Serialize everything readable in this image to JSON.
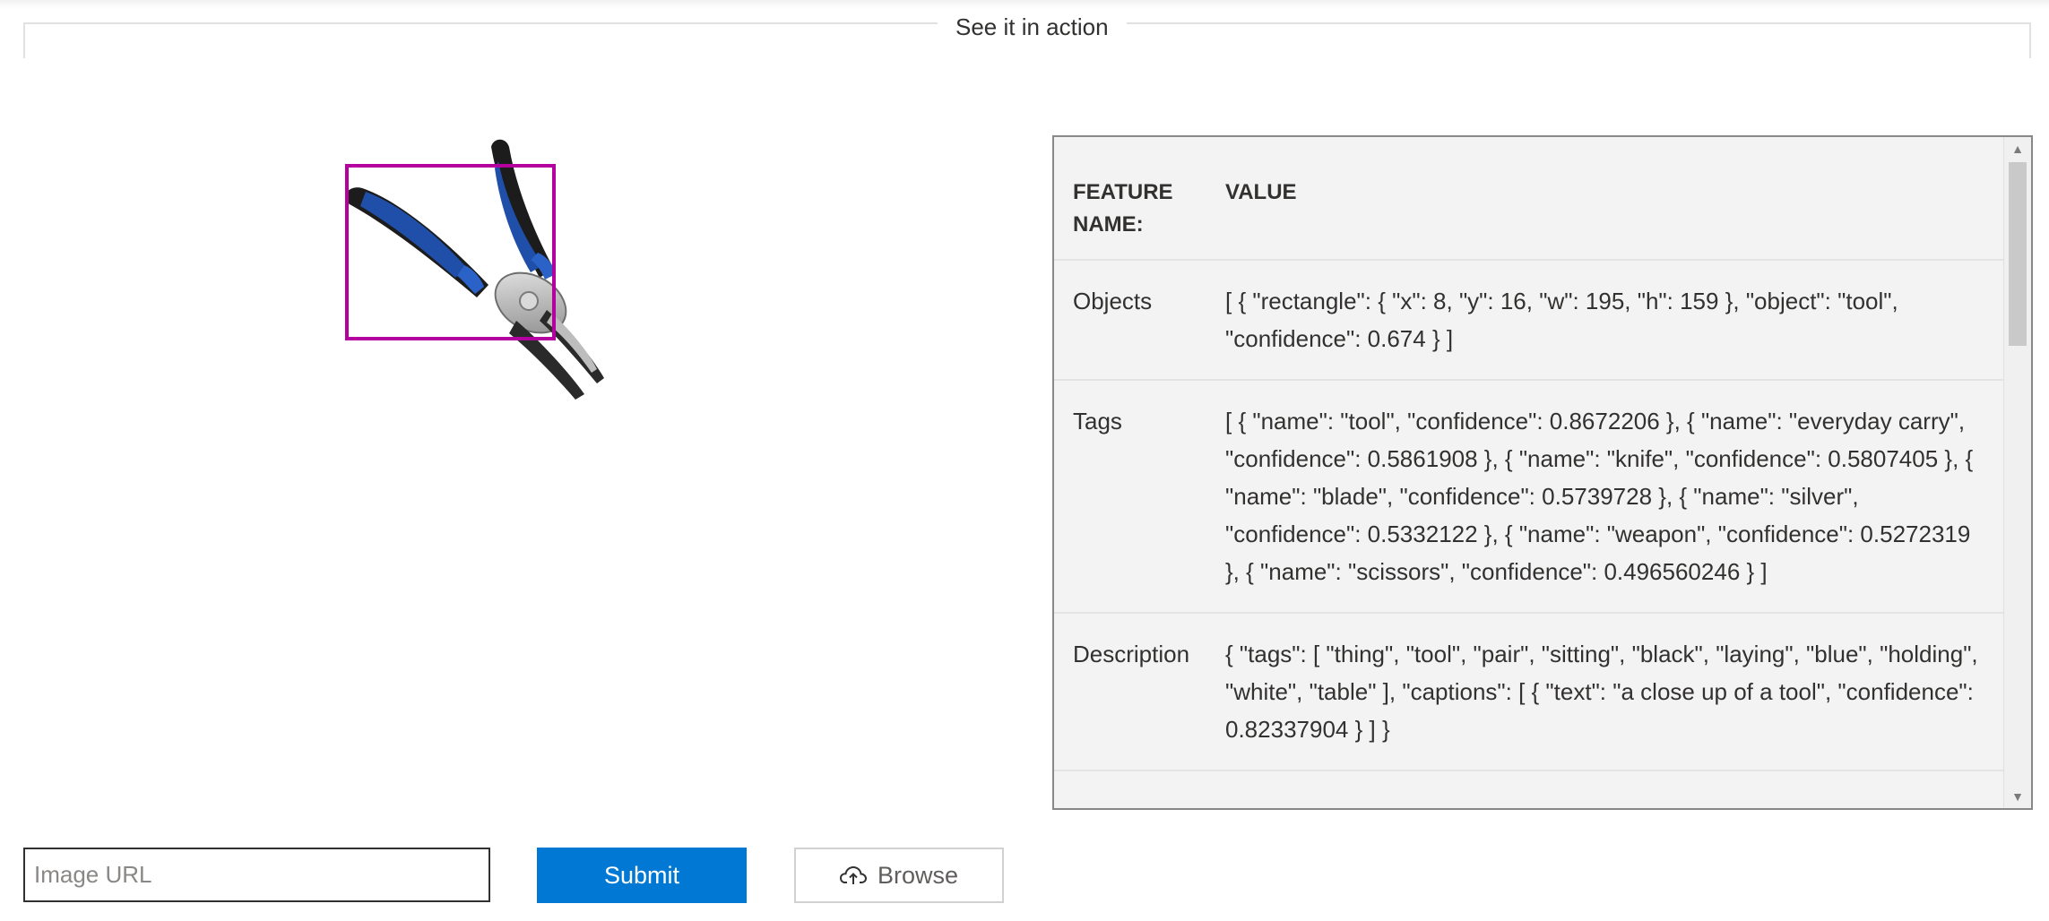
{
  "section": {
    "legend": "See it in action"
  },
  "preview": {
    "image_icon": "pliers-image",
    "bounding_box_color": "#b4009e"
  },
  "results": {
    "header": {
      "name": "FEATURE NAME:",
      "value": "VALUE"
    },
    "rows": [
      {
        "name": "Objects",
        "value": "[ { \"rectangle\": { \"x\": 8, \"y\": 16, \"w\": 195, \"h\": 159 }, \"object\": \"tool\", \"confidence\": 0.674 } ]"
      },
      {
        "name": "Tags",
        "value": "[ { \"name\": \"tool\", \"confidence\": 0.8672206 }, { \"name\": \"everyday carry\", \"confidence\": 0.5861908 }, { \"name\": \"knife\", \"confidence\": 0.5807405 }, { \"name\": \"blade\", \"confidence\": 0.5739728 }, { \"name\": \"silver\", \"confidence\": 0.5332122 }, { \"name\": \"weapon\", \"confidence\": 0.5272319 }, { \"name\": \"scissors\", \"confidence\": 0.496560246 } ]"
      },
      {
        "name": "Description",
        "value": "{ \"tags\": [ \"thing\", \"tool\", \"pair\", \"sitting\", \"black\", \"laying\", \"blue\", \"holding\", \"white\", \"table\" ], \"captions\": [ { \"text\": \"a close up of a tool\", \"confidence\": 0.82337904 } ] }"
      }
    ]
  },
  "controls": {
    "url_placeholder": "Image URL",
    "url_value": "",
    "submit_label": "Submit",
    "browse_label": "Browse",
    "browse_icon": "cloud-upload-icon",
    "accent_color": "#0078d4"
  }
}
